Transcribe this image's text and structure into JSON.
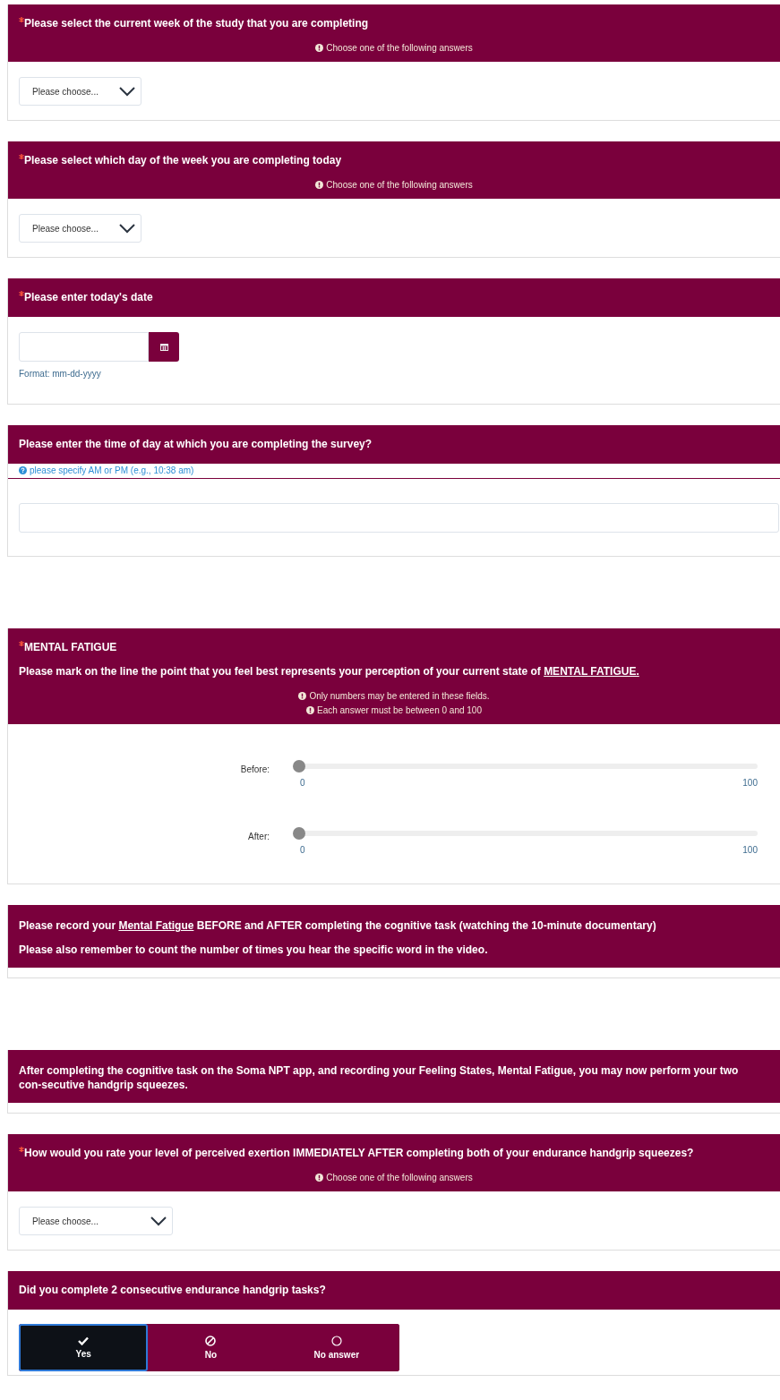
{
  "groups": [
    {
      "questions": [
        {
          "kind": "select",
          "required": true,
          "title": "Please select the current week of the study that you are completing",
          "hints": [
            "Choose one of the following answers"
          ],
          "placeholder": "Please choose..."
        },
        {
          "kind": "select",
          "required": true,
          "title": "Please select which day of the week you are completing today",
          "hints": [
            "Choose one of the following answers"
          ],
          "placeholder": "Please choose..."
        },
        {
          "kind": "date",
          "required": true,
          "title": "Please enter today's date",
          "format": "Format: mm-dd-yyyy"
        },
        {
          "kind": "text",
          "required": false,
          "title": "Please enter the time of day at which you are completing the survey?",
          "help": "please specify AM or PM (e.g., 10:38 am)"
        }
      ]
    },
    {
      "questions": [
        {
          "kind": "slider",
          "required": true,
          "title": "MENTAL FATIGUE",
          "description": [
            "Please mark on the line the point that you feel best represents your perception of your current state of **MENTAL FATIGUE.**"
          ],
          "hints": [
            "Only numbers may be entered in these fields.",
            "Each answer must be between 0 and 100"
          ],
          "sliders": [
            {
              "label": "Before:",
              "level": 0,
              "min": "0",
              "max": "100"
            },
            {
              "label": "After:",
              "level": 0,
              "min": "0",
              "max": "100"
            }
          ]
        },
        {
          "kind": "display",
          "required": false,
          "description": [
            "Please record your *Mental Fatigue* BEFORE and AFTER completing the cognitive task (watching the 10-minute documentary)",
            "Please also remember to count the number of times you hear the specific word in the video."
          ]
        }
      ]
    },
    {
      "questions": [
        {
          "kind": "display",
          "required": false,
          "description": [
            "After completing the cognitive task on the Soma NPT app, and recording your Feeling States, Mental Fatigue, you may now perform your two con-secutive handgrip squeezes."
          ]
        },
        {
          "kind": "select",
          "required": true,
          "title": "How would you rate your level of perceived exertion IMMEDIATELY AFTER completing both of your endurance handgrip squeezes?",
          "hints": [
            "Choose one of the following answers"
          ],
          "placeholder": "Please choose...",
          "wide": true
        },
        {
          "kind": "choice",
          "required": false,
          "title": "Did you complete 2 consecutive endurance handgrip tasks?",
          "options": [
            {
              "kind": "yes",
              "label": "Yes",
              "selected": true
            },
            {
              "kind": "no",
              "label": "No",
              "selected": false
            },
            {
              "kind": "no_answer",
              "label": "No answer",
              "selected": false
            }
          ]
        }
      ]
    }
  ]
}
